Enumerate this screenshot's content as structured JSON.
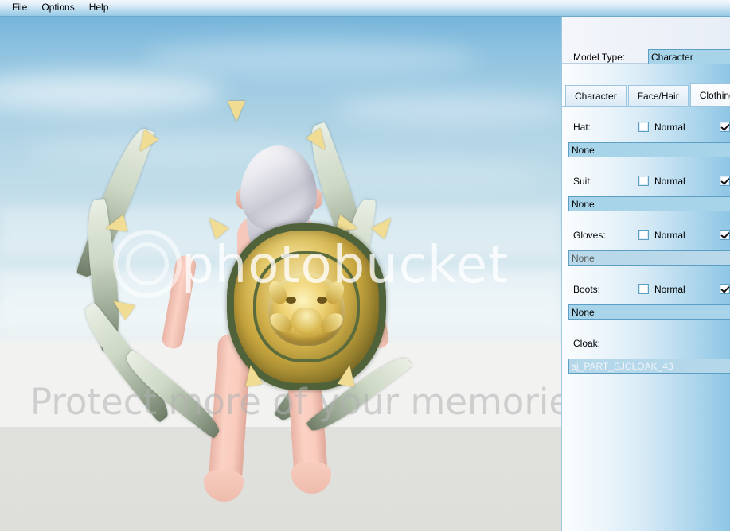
{
  "menu": {
    "items": [
      {
        "label": "File"
      },
      {
        "label": "Options"
      },
      {
        "label": "Help"
      }
    ]
  },
  "panel": {
    "model_type": {
      "label": "Model Type:",
      "value": "Character"
    },
    "tabs": [
      {
        "label": "Character",
        "active": false
      },
      {
        "label": "Face/Hair",
        "active": false
      },
      {
        "label": "Clothing",
        "active": true
      }
    ],
    "slots": [
      {
        "label": "Hat:",
        "normal_label": "Normal",
        "normal_checked": false,
        "enabled_checked": true,
        "value": "None"
      },
      {
        "label": "Suit:",
        "normal_label": "Normal",
        "normal_checked": false,
        "enabled_checked": true,
        "value": "None"
      },
      {
        "label": "Gloves:",
        "normal_label": "Normal",
        "normal_checked": false,
        "enabled_checked": true,
        "value": "None"
      },
      {
        "label": "Boots:",
        "normal_label": "Normal",
        "normal_checked": false,
        "enabled_checked": true,
        "value": "None"
      },
      {
        "label": "Cloak:",
        "normal_label": "",
        "normal_checked": null,
        "enabled_checked": null,
        "value": "sj_PART_SJCLOAK_43"
      }
    ]
  },
  "viewport": {
    "watermark_brand": "photobucket",
    "watermark_tagline": "Protect more of your memories for less!"
  },
  "colors": {
    "menubar_top": "#f2f8fc",
    "menubar_bottom": "#95c9e6",
    "panel_left": "#fbfdfe",
    "panel_right": "#8ec6e4",
    "field_fill": "#a8d4ea",
    "field_border": "#5d9fc4",
    "sky_top": "#76b4da",
    "ground": "#dededa"
  }
}
